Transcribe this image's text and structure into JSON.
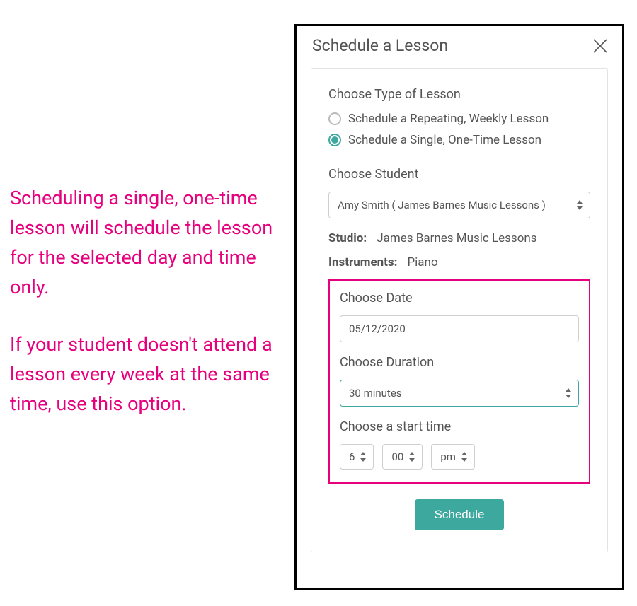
{
  "help": {
    "p1": "Scheduling a single, one-time lesson will schedule the lesson for the selected day and time only.",
    "p2": "If your student doesn't attend a lesson every week at the same time, use this option."
  },
  "modal": {
    "title": "Schedule a Lesson",
    "lesson_type": {
      "label": "Choose Type of Lesson",
      "option_repeating": "Schedule a Repeating, Weekly Lesson",
      "option_single": "Schedule a Single, One-Time Lesson",
      "selected": "single"
    },
    "student": {
      "label": "Choose Student",
      "value": "Amy Smith ( James Barnes Music Lessons )"
    },
    "studio": {
      "k": "Studio:",
      "v": "James Barnes Music Lessons"
    },
    "instruments": {
      "k": "Instruments:",
      "v": "Piano"
    },
    "date": {
      "label": "Choose Date",
      "value": "05/12/2020"
    },
    "duration": {
      "label": "Choose Duration",
      "value": "30 minutes"
    },
    "start_time": {
      "label": "Choose a start time",
      "hour": "6",
      "minute": "00",
      "ampm": "pm"
    },
    "submit": "Schedule"
  }
}
